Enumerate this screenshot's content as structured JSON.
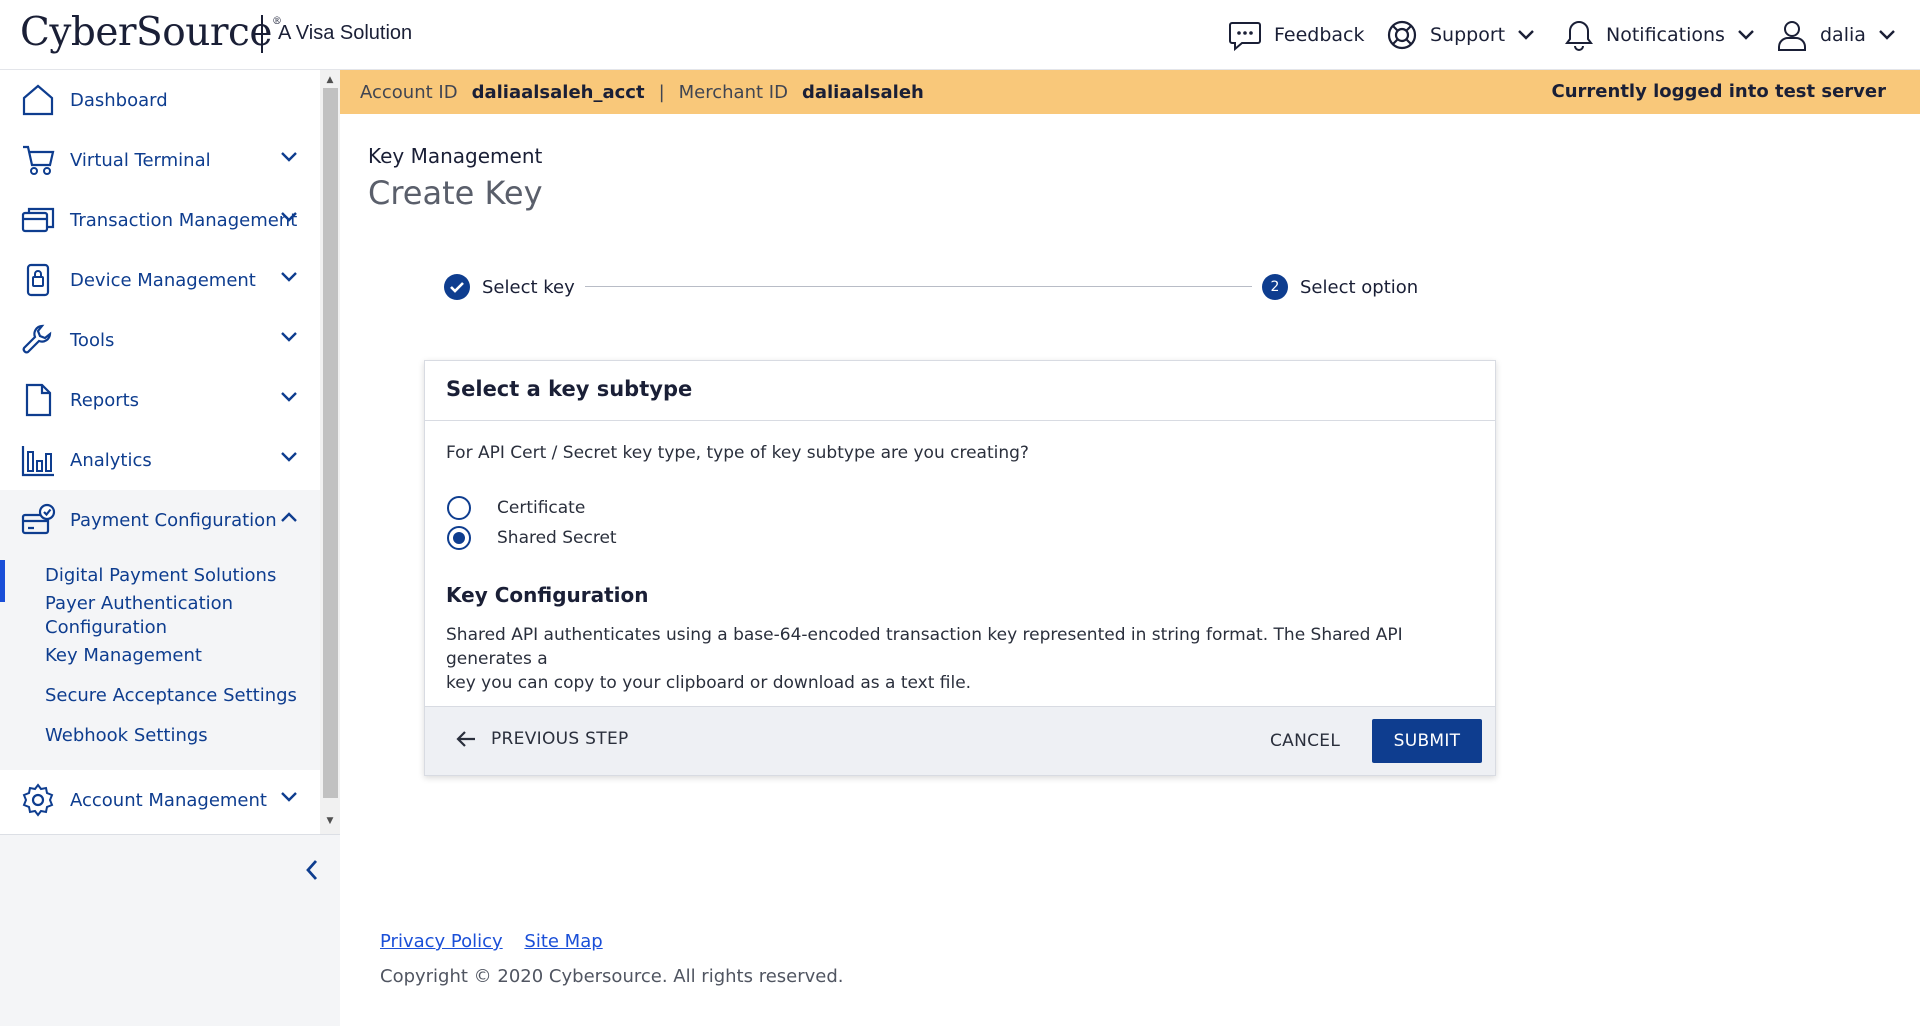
{
  "header": {
    "logo_text": "CyberSource",
    "logo_mark": "®",
    "logo_sub": "A Visa Solution",
    "feedback": "Feedback",
    "support": "Support",
    "notifications": "Notifications",
    "user": "dalia",
    "icons": [
      "chat-icon",
      "lifebuoy-icon",
      "bell-icon",
      "user-icon"
    ]
  },
  "sidebar": {
    "items": [
      {
        "label": "Dashboard",
        "icon": "home-icon"
      },
      {
        "label": "Virtual Terminal",
        "icon": "cart-icon"
      },
      {
        "label": "Transaction Management",
        "icon": "cards-icon"
      },
      {
        "label": "Device Management",
        "icon": "device-icon"
      },
      {
        "label": "Tools",
        "icon": "wrench-icon"
      },
      {
        "label": "Reports",
        "icon": "document-icon"
      },
      {
        "label": "Analytics",
        "icon": "bar-chart-icon"
      },
      {
        "label": "Payment Configuration",
        "icon": "card-check-icon"
      },
      {
        "label": "Account Management",
        "icon": "gear-icon"
      }
    ],
    "sub_items": [
      "Digital Payment Solutions",
      "Payer Authentication",
      "Configuration",
      "Key Management",
      "Secure Acceptance Settings",
      "Webhook Settings"
    ],
    "active_sub": "Key Management"
  },
  "banner": {
    "account_label": "Account ID",
    "account_value": "daliaalsaleh_acct",
    "separator": "|",
    "merchant_label": "Merchant ID",
    "merchant_value": "daliaalsaleh",
    "status": "Currently logged into test server",
    "color": "#f9c87a"
  },
  "main": {
    "breadcrumb": "Key Management",
    "title": "Create Key",
    "steps": [
      {
        "label": "Select key",
        "state": "complete"
      },
      {
        "label": "Select option",
        "number": "2",
        "state": "current"
      }
    ]
  },
  "card": {
    "title": "Select a key subtype",
    "question": "For API Cert / Secret key type, type of key subtype are you creating?",
    "options": [
      {
        "label": "Certificate",
        "checked": false
      },
      {
        "label": "Shared Secret",
        "checked": true
      }
    ],
    "config_title": "Key Configuration",
    "config_desc_line1": "Shared API authenticates using a base-64-encoded transaction key represented in string format. The Shared API generates a",
    "config_desc_line2": "key you can copy to your clipboard or download as a text file.",
    "prev_label": "PREVIOUS STEP",
    "cancel_label": "CANCEL",
    "submit_label": "SUBMIT",
    "accent_color": "#0e3d8f"
  },
  "footer": {
    "privacy": "Privacy Policy",
    "sitemap": "Site Map",
    "copyright": "Copyright © 2020 Cybersource. All rights reserved."
  }
}
